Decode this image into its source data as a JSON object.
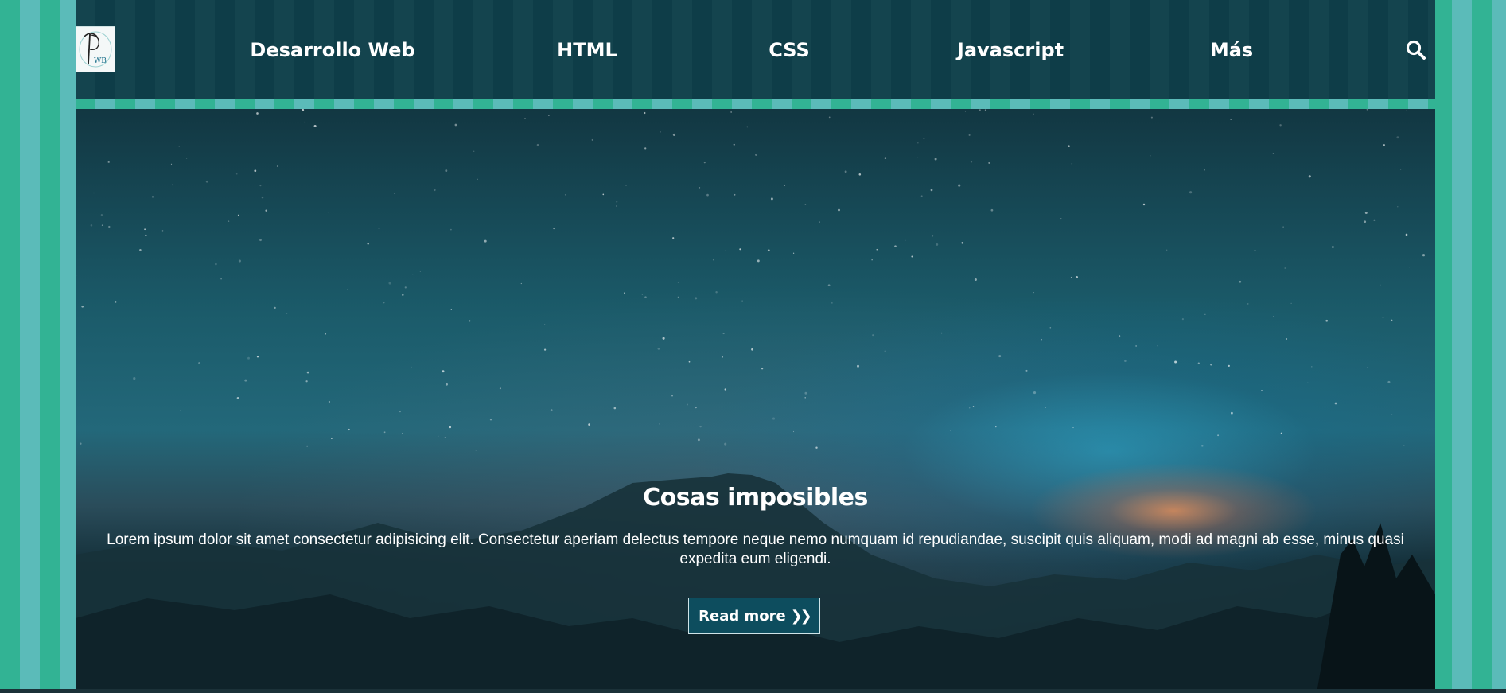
{
  "logo": {
    "alt": "logo"
  },
  "nav": {
    "items": [
      {
        "label": "Desarrollo Web"
      },
      {
        "label": "HTML"
      },
      {
        "label": "CSS"
      },
      {
        "label": "Javascript"
      },
      {
        "label": "Más"
      }
    ],
    "search_icon": "search-icon"
  },
  "hero": {
    "title": "Cosas imposibles",
    "text": "Lorem ipsum dolor sit amet consectetur adipisicing elit. Consectetur aperiam delectus tempore neque nemo numquam id repudiandae, suscipit quis aliquam, modi ad magni ab esse, minus quasi expedita eum eligendi.",
    "button_label": "Read more",
    "button_icon": "double-chevron-right-icon"
  },
  "colors": {
    "stripe_a": "#32b394",
    "stripe_b": "#5bbbb9",
    "header_bg": "#0e3f4a",
    "button_bg": "#0d4d5e"
  }
}
